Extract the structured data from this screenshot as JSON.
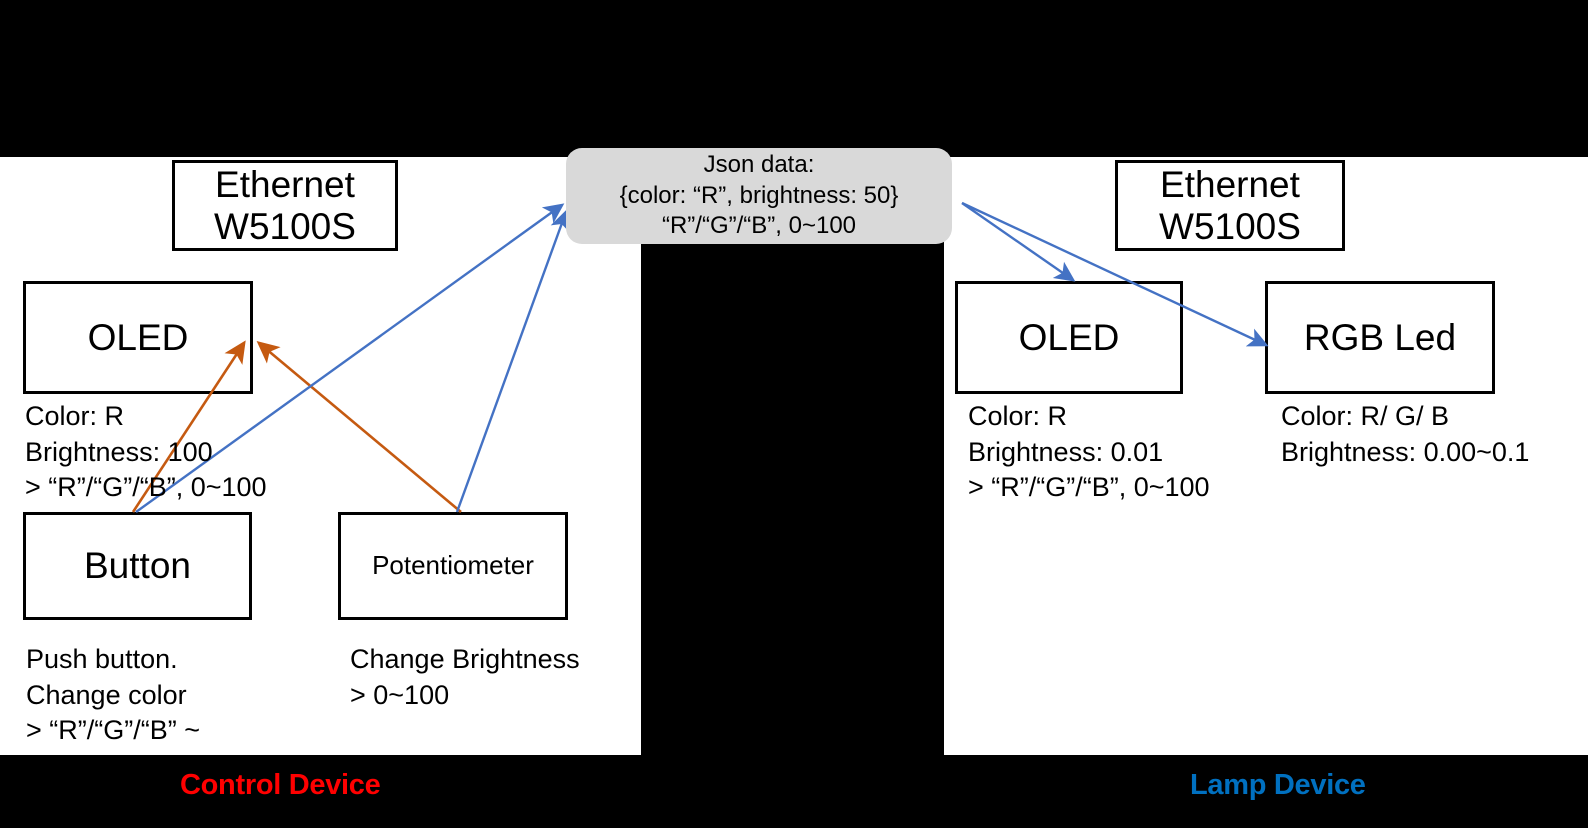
{
  "colors": {
    "background": "#000000",
    "panel": "#ffffff",
    "json_box": "#d9d9d9",
    "orange_arrow": "#c55a11",
    "blue_arrow": "#4472c4",
    "control_label": "#ff0000",
    "lamp_label": "#0070c0",
    "node_border": "#000000"
  },
  "json_packet": {
    "title": "Json data:",
    "line1": "{color: “R”, brightness: 50}",
    "line2": "“R”/“G”/“B”, 0~100"
  },
  "control_device": {
    "label": "Control Device",
    "ethernet": "Ethernet\nW5100S",
    "oled": "OLED",
    "oled_caption": "Color: R\nBrightness: 100\n > “R”/“G”/“B”, 0~100",
    "button": "Button",
    "button_caption": "Push button.\nChange color\n> “R”/“G”/“B” ~",
    "potentiometer": "Potentiometer",
    "potentiometer_caption": "Change Brightness\n> 0~100"
  },
  "lamp_device": {
    "label": "Lamp Device",
    "ethernet": "Ethernet\nW5100S",
    "oled": "OLED",
    "oled_caption": "Color: R\nBrightness: 0.01\n > “R”/“G”/“B”, 0~100",
    "rgb_led": "RGB Led",
    "rgb_led_caption": "Color: R/ G/ B\nBrightness: 0.00~0.1"
  },
  "connections": [
    {
      "name": "button-to-oled",
      "color": "#c55a11",
      "from": "Button",
      "to": "OLED (Control)"
    },
    {
      "name": "potentiometer-to-oled",
      "color": "#c55a11",
      "from": "Potentiometer",
      "to": "OLED (Control)"
    },
    {
      "name": "button-to-json",
      "color": "#4472c4",
      "from": "Button",
      "to": "Json data"
    },
    {
      "name": "potentiometer-to-json",
      "color": "#4472c4",
      "from": "Potentiometer",
      "to": "Json data"
    },
    {
      "name": "json-to-lamp-oled",
      "color": "#4472c4",
      "from": "Json data",
      "to": "OLED (Lamp)"
    },
    {
      "name": "json-to-rgb-led",
      "color": "#4472c4",
      "from": "Json data",
      "to": "RGB Led"
    }
  ]
}
